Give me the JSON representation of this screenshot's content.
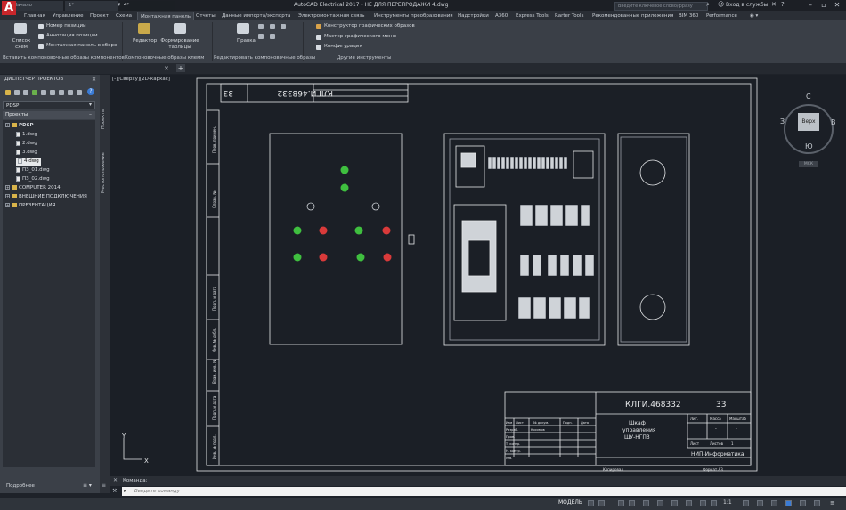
{
  "app": {
    "logo_letter": "A",
    "title": "AutoCAD Electrical 2017 - НЕ ДЛЯ ПЕРЕПРОДАЖИ    4.dwg",
    "signin_placeholder": "Введите ключевое слово/фразу",
    "user_menu": "Вход в службы"
  },
  "ribbon": {
    "tabs": [
      "Главная",
      "Управление",
      "Проект",
      "Схема",
      "Монтажная панель",
      "Отчеты",
      "Данные импорта/экспорта",
      "Электромонтажная связь",
      "Инструменты преобразования",
      "Надстройки",
      "A360",
      "Express Tools",
      "Rarter Tools",
      "Рекомендованные приложения",
      "BIM 360",
      "Performance"
    ],
    "active_tab_index": 4,
    "list_schemes": "Список схем",
    "cmd_position_number": "Номер позиции",
    "cmd_annotation": "Аннотация позиции",
    "cmd_panel_in_assembly": "Монтажная панель в сборе",
    "editor": "Редактор",
    "build_tables": "Формирование таблицы",
    "edit": "Правка",
    "graphic_builder": "Конструктор графических образов",
    "graphic_menu_wizard": "Мастер графического меню",
    "configuration": "Конфигурация",
    "footer_insert": "Вставить компоновочные образы компонентов",
    "footer_terminals": "Компоновочные образы клемм",
    "footer_edit": "Редактировать компоновочные образы",
    "footer_other": "Другие инструменты"
  },
  "doc_tabs": [
    "Начало",
    "1*",
    "4*"
  ],
  "project_manager": {
    "title": "ДИСПЕТЧЕР ПРОЕКТОВ",
    "selected_project": "PDSP",
    "projects_header": "Проекты",
    "tree": [
      {
        "label": "PDSP",
        "level": 0,
        "type": "project",
        "bold": true
      },
      {
        "label": "1.dwg",
        "level": 1,
        "type": "dwg"
      },
      {
        "label": "2.dwg",
        "level": 1,
        "type": "dwg"
      },
      {
        "label": "3.dwg",
        "level": 1,
        "type": "dwg"
      },
      {
        "label": "4.dwg",
        "level": 1,
        "type": "dwg",
        "selected": true
      },
      {
        "label": "ПЗ_01.dwg",
        "level": 1,
        "type": "dwg"
      },
      {
        "label": "ПЗ_02.dwg",
        "level": 1,
        "type": "dwg"
      },
      {
        "label": "COMPUTER 2014",
        "level": 0,
        "type": "project"
      },
      {
        "label": "ВНЕШНИЕ ПОДКЛЮЧЕНИЯ",
        "level": 0,
        "type": "project"
      },
      {
        "label": "ПРЕЗЕНТАЦИЯ",
        "level": 0,
        "type": "project"
      }
    ],
    "details": "Подробнее",
    "vtab_projects": "Проекты",
    "vtab_location": "Местоположение"
  },
  "viewport": {
    "label": "[-][Сверху][2D-каркас]",
    "viewcube": {
      "top": "Верх",
      "n": "С",
      "s": "Ю",
      "w": "З",
      "e": "В",
      "wcs": "МСК"
    },
    "ucs_x": "X",
    "ucs_y": "Y"
  },
  "drawing": {
    "doc_code_rot": "КЛГИ.468332",
    "sheet_rot": "33",
    "side_labels": [
      "Перв. примен.",
      "Справ. №",
      "Подп. и дата",
      "Инв. № дубл.",
      "Взам. инв. №",
      "Подп. и дата",
      "Инв. № подл."
    ],
    "title_block": {
      "code": "КЛГИ.468332",
      "sheet": "33",
      "name_line1": "Шкаф",
      "name_line2": "управления",
      "name_line3": "ШУ-НГП3",
      "org": "НИП-Информатика",
      "row_labels": [
        "Изм",
        "Лист",
        "№ докум.",
        "Подп.",
        "Дата",
        "Разраб.",
        "Пров.",
        "Т. контр.",
        "Н. контр.",
        "Утв."
      ],
      "developer": "Косимов",
      "col_lit": "Лит.",
      "col_mass": "Масса",
      "col_scale": "Масштаб",
      "dash": "-",
      "sheet_lbl": "Лист",
      "sheets_lbl": "Листов",
      "sheets_val": "1",
      "copied": "Копировал",
      "format": "Формат А3"
    }
  },
  "command": {
    "history": "Команда:",
    "placeholder": "Введите команду"
  },
  "status": {
    "model": "МОДЕЛЬ",
    "scale": "1:1"
  }
}
